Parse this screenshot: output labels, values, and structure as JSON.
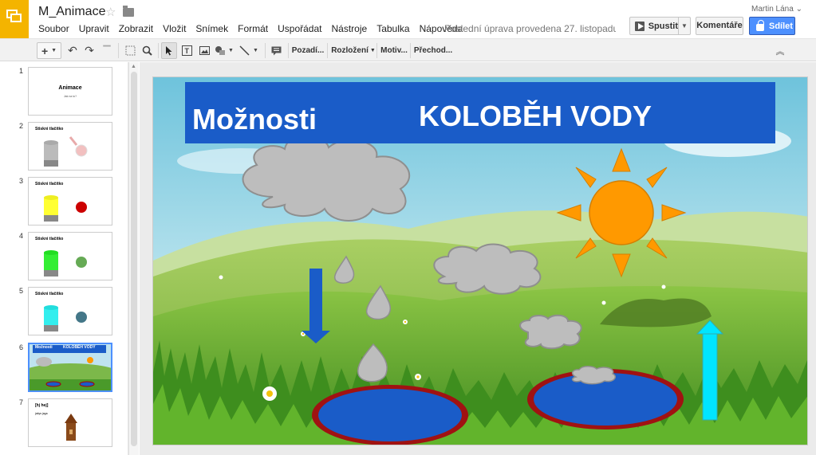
{
  "header": {
    "doc_title": "M_Animace",
    "menu": [
      "Soubor",
      "Upravit",
      "Zobrazit",
      "Vložit",
      "Snímek",
      "Formát",
      "Uspořádat",
      "Nástroje",
      "Tabulka",
      "Nápověda"
    ],
    "last_edit": "Poslední úprava provedena 27. listopadu 2...",
    "user": "Martin Lána",
    "present_label": "Spustit",
    "comments_label": "Komentáře",
    "share_label": "Sdílet"
  },
  "toolbar": {
    "background_label": "Pozadí...",
    "layout_label": "Rozložení",
    "theme_label": "Motiv...",
    "transition_label": "Přechod..."
  },
  "colors": {
    "accent": "#4d90fe",
    "title_bar": "#1a5cc8",
    "sun": "#ff9900",
    "pond": "#1a5cc8",
    "pond_rim": "#b01010",
    "arrow_down": "#1a5cc8",
    "arrow_up": "#00e5ff"
  },
  "slides": [
    {
      "num": "1",
      "title": "Animace",
      "subtitle": "Jak na to?"
    },
    {
      "num": "2",
      "title": "Stiskni tlačítko"
    },
    {
      "num": "3",
      "title": "Stiskni tlačítko"
    },
    {
      "num": "4",
      "title": "Stiskni tlačítko"
    },
    {
      "num": "5",
      "title": "Stiskni tlačítko"
    },
    {
      "num": "6",
      "title_left": "Možnosti",
      "title_right": "KOLOBĚH VODY"
    },
    {
      "num": "7",
      "title": "[hj hej]",
      "subtitle": "jakys jaga"
    }
  ],
  "current_slide": {
    "title_left": "Možnosti",
    "title_right": "KOLOBĚH VODY"
  }
}
